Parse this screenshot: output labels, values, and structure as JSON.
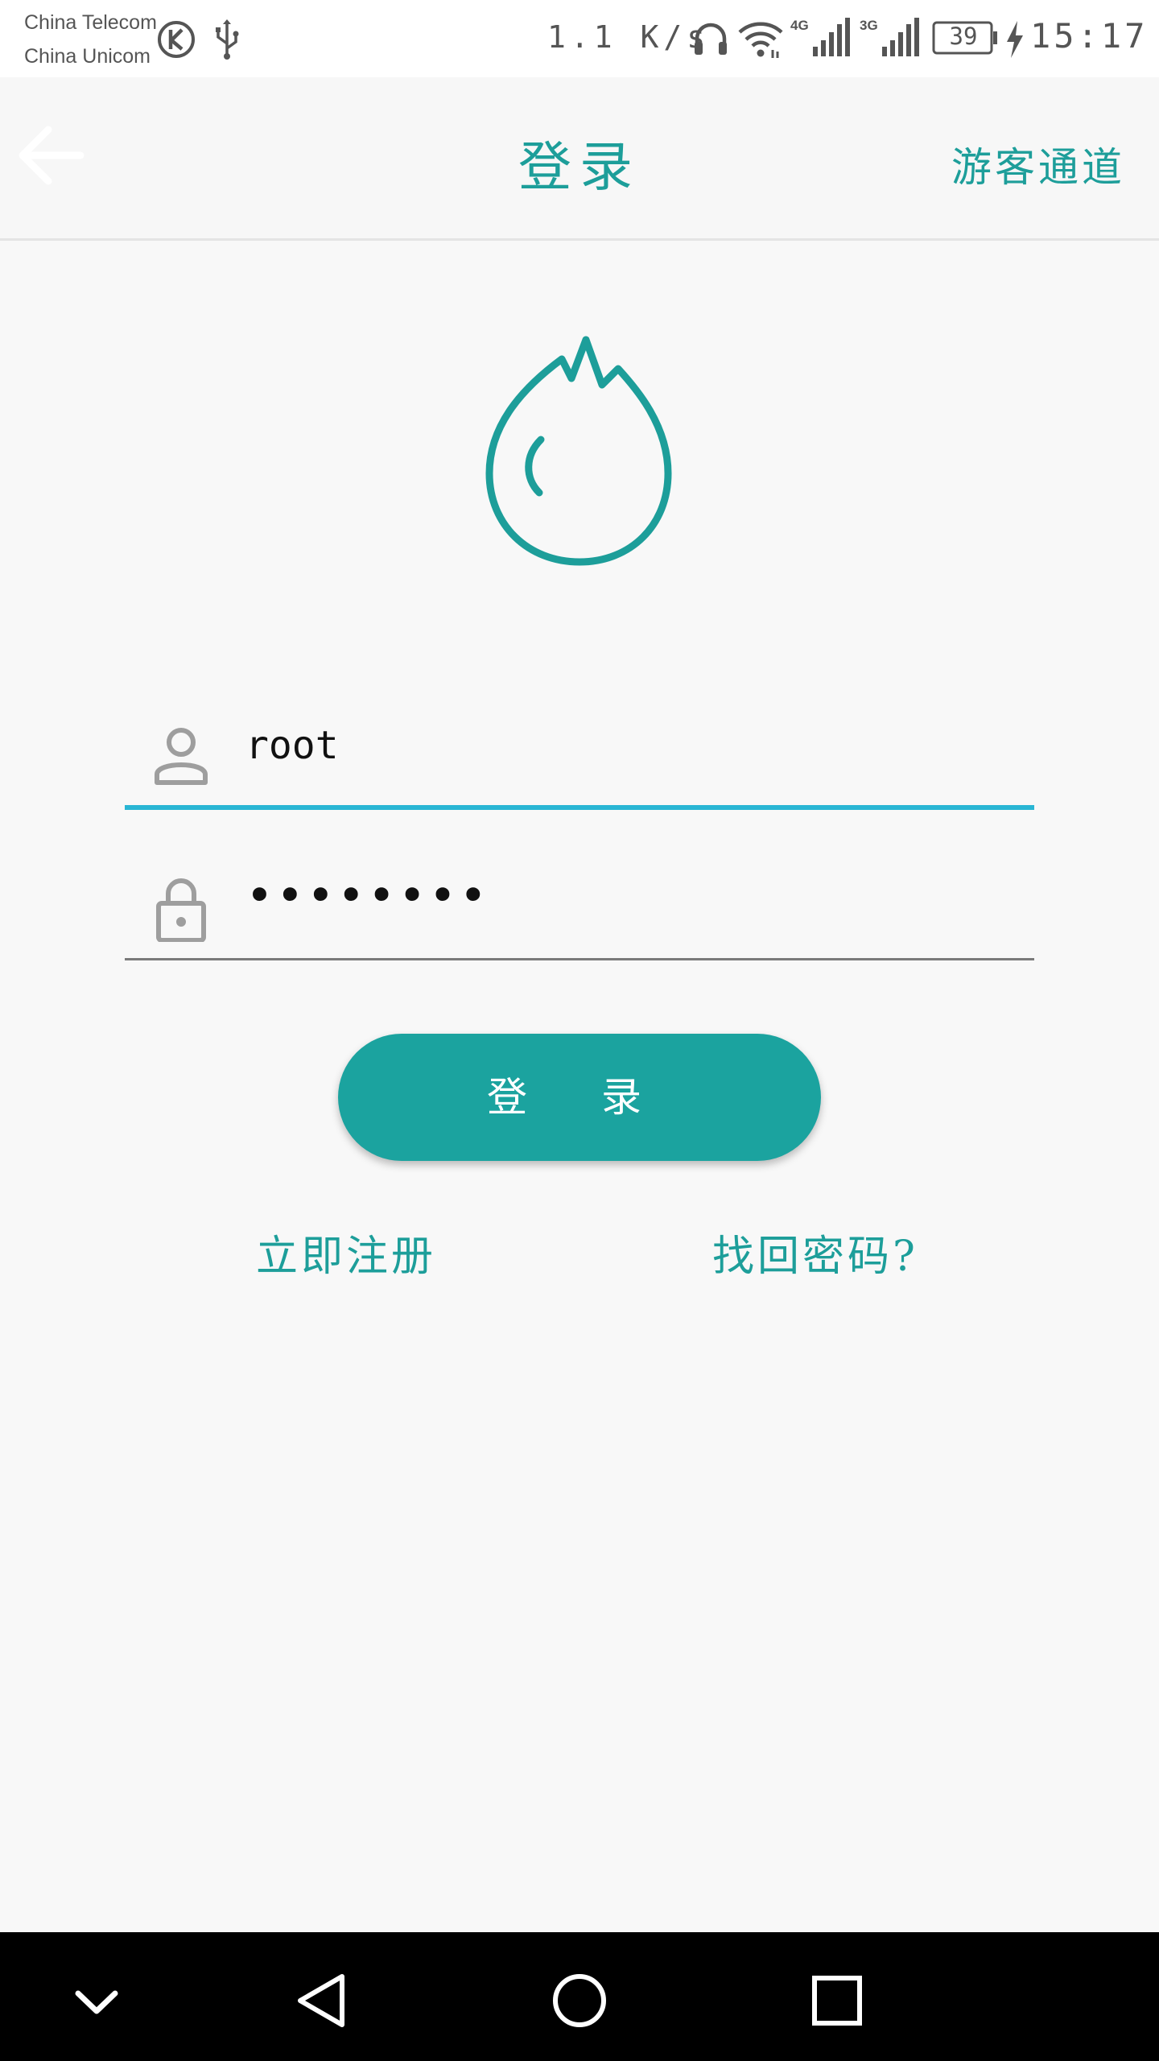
{
  "status_bar": {
    "carrier_1": "China Telecom",
    "carrier_2": "China Unicom",
    "net_speed": "1.1 K/s",
    "network_1": "4G",
    "network_2": "3G",
    "battery_level": "39",
    "time": "15:17",
    "icons": [
      "k-app-icon",
      "usb-icon",
      "headset-icon",
      "wifi-icon",
      "signal-4g-icon",
      "signal-3g-icon",
      "battery-icon",
      "charging-icon"
    ]
  },
  "app_bar": {
    "back_icon": "arrow-left-icon",
    "title": "登录",
    "guest_entry": "游客通道"
  },
  "logo": {
    "icon": "flame-drop-logo",
    "color": "#1d9e9a"
  },
  "form": {
    "username": {
      "icon": "user-icon",
      "value": "root"
    },
    "password": {
      "icon": "lock-icon",
      "value": "••••••••"
    },
    "login_button": "登 录"
  },
  "links": {
    "register": "立即注册",
    "forgot_password": "找回密码?"
  },
  "nav_bar": {
    "icons": [
      "chevron-down-icon",
      "back-triangle-icon",
      "home-circle-icon",
      "recents-square-icon"
    ]
  },
  "colors": {
    "accent": "#1d9e9a",
    "button": "#1ba39f",
    "active_underline": "#29b6d4",
    "background": "#f8f8f8"
  }
}
